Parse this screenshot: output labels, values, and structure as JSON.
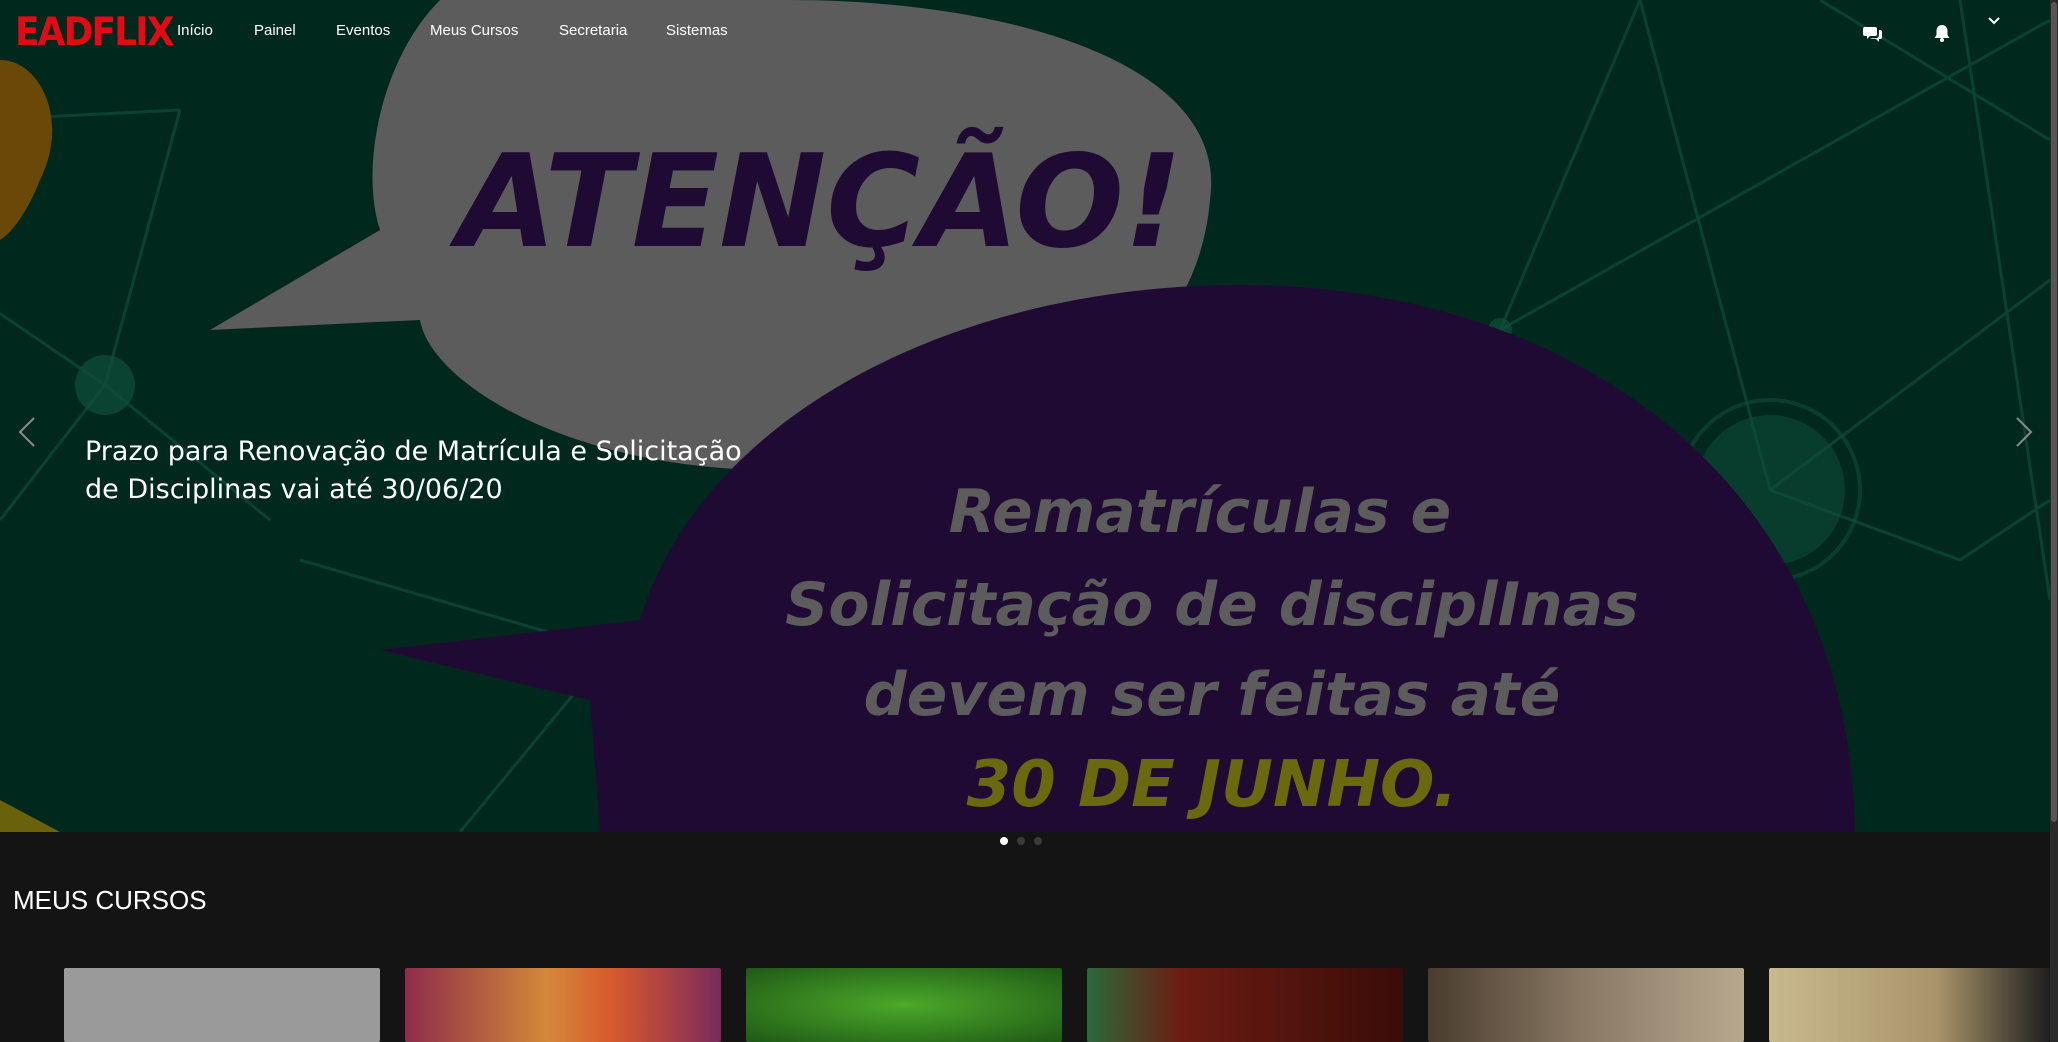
{
  "brand": {
    "logo": "EADFLIX",
    "accent": "#e50914"
  },
  "nav": {
    "links": [
      "Início",
      "Painel",
      "Eventos",
      "Meus Cursos",
      "Secretaria",
      "Sistemas"
    ],
    "icons": [
      "chat-icon",
      "bell-icon",
      "chevron-down-icon"
    ]
  },
  "hero": {
    "headline": "ATENÇÃO!",
    "body_lines": [
      "Rematrículas e",
      "Solicitação de disciplInas",
      "devem ser feitas até"
    ],
    "deadline": "30 DE JUNHO.",
    "caption": "Prazo para Renovação de Matrícula e Solicitação de Disciplinas vai até 30/06/20",
    "colors": {
      "background": "#00503a",
      "bubble_light": "#b8b8b8",
      "bubble_purple": "#3f1567",
      "text_purple": "#3f1567",
      "deadline_yellow": "#d4d21a"
    },
    "active_slide": 1,
    "slide_count": 3
  },
  "section": {
    "title": "MEUS CURSOS"
  },
  "courses": [
    {
      "thumb_color": "#9a9a9a"
    },
    {
      "thumb_color": "#b2473a"
    },
    {
      "thumb_color": "#3c8a1c"
    },
    {
      "thumb_color": "#5a1a10"
    },
    {
      "thumb_color": "#6f6255"
    },
    {
      "thumb_color": "#c9b98e"
    }
  ]
}
